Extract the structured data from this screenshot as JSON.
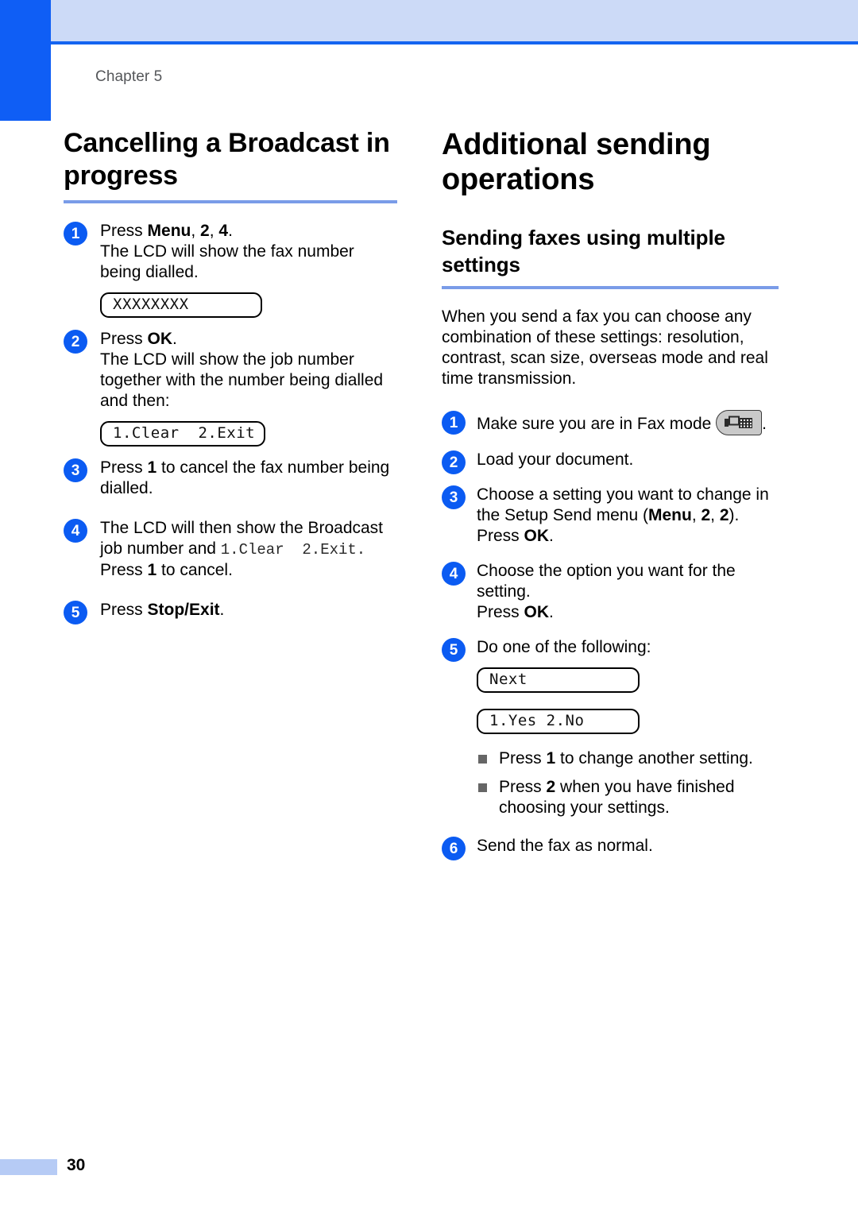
{
  "page": {
    "chapter_label": "Chapter 5",
    "page_number": "30",
    "accent_blue": "#0f5ef5",
    "header_band": "#ccdaf7",
    "rule_blue": "#7a9ce8",
    "footer_bar": "#b6cbf5"
  },
  "left_column": {
    "heading": "Cancelling a Broadcast in progress",
    "steps": [
      {
        "number": "1",
        "lines": [
          "Press Menu, 2, 4.",
          "The LCD will show the fax number being dialled."
        ],
        "lcd": "XXXXXXXX"
      },
      {
        "number": "2",
        "lines": [
          "Press OK.",
          "The LCD will show the job number together with the number being dialled and then:"
        ],
        "lcd": "1.Clear  2.Exit"
      },
      {
        "number": "3",
        "lines": [
          "Press 1 to cancel the fax number being dialled."
        ],
        "lcd": null
      },
      {
        "number": "4",
        "lines": [
          "The LCD will then show the Broadcast job number and 1.Clear  2.Exit. Press 1 to cancel."
        ],
        "lcd": null
      },
      {
        "number": "5",
        "lines": [
          "Press Stop/Exit."
        ],
        "lcd": null
      }
    ]
  },
  "right_column": {
    "heading": "Additional sending operations",
    "subheading": "Sending faxes using multiple settings",
    "intro": "When you send a fax you can choose any combination of these settings: resolution, contrast, scan size, overseas mode and real time transmission.",
    "steps": [
      {
        "number": "1",
        "text": "Make sure you are in Fax mode",
        "icon": "fax-mode-icon",
        "trailing": "."
      },
      {
        "number": "2",
        "text": "Load your document."
      },
      {
        "number": "3",
        "text": "Choose a setting you want to change in the Setup Send menu (Menu, 2, 2). Press OK."
      },
      {
        "number": "4",
        "text": "Choose the option you want for the setting. Press OK."
      },
      {
        "number": "5",
        "text": "Do one of the following:"
      },
      {
        "number": "6",
        "text": "Send the fax as normal."
      }
    ],
    "lcd_next": "Next",
    "lcd_yesno": "1.Yes 2.No",
    "bullets": [
      "Press 1 to change another setting.",
      "Press 2 when you have finished choosing your settings."
    ]
  }
}
